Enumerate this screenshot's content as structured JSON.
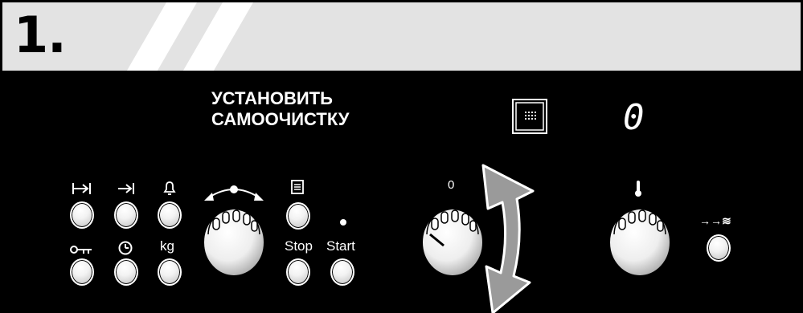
{
  "step_number": "1.",
  "message": {
    "line1": "УСТАНОВИТЬ",
    "line2": "САМООЧИСТКУ"
  },
  "display": {
    "digit": "0",
    "selftest_symbol": "grid-icon"
  },
  "left_buttons": {
    "row1_icons": [
      "duration-icon",
      "end-time-icon",
      "timer-bell-icon"
    ],
    "row2": {
      "lock_icon": "key-icon",
      "clock_icon": "clock-icon",
      "weight_label": "kg"
    }
  },
  "function_button_icon": "program-list-icon",
  "stop_label": "Stop",
  "start_label": "Start",
  "center_knob_label": "0",
  "temp_icon": "thermometer-icon",
  "rapid_heat_label": "→→≋",
  "colors": {
    "panel": "#000000",
    "header": "#e3e3e3",
    "arrow": "#9a9a9a"
  }
}
